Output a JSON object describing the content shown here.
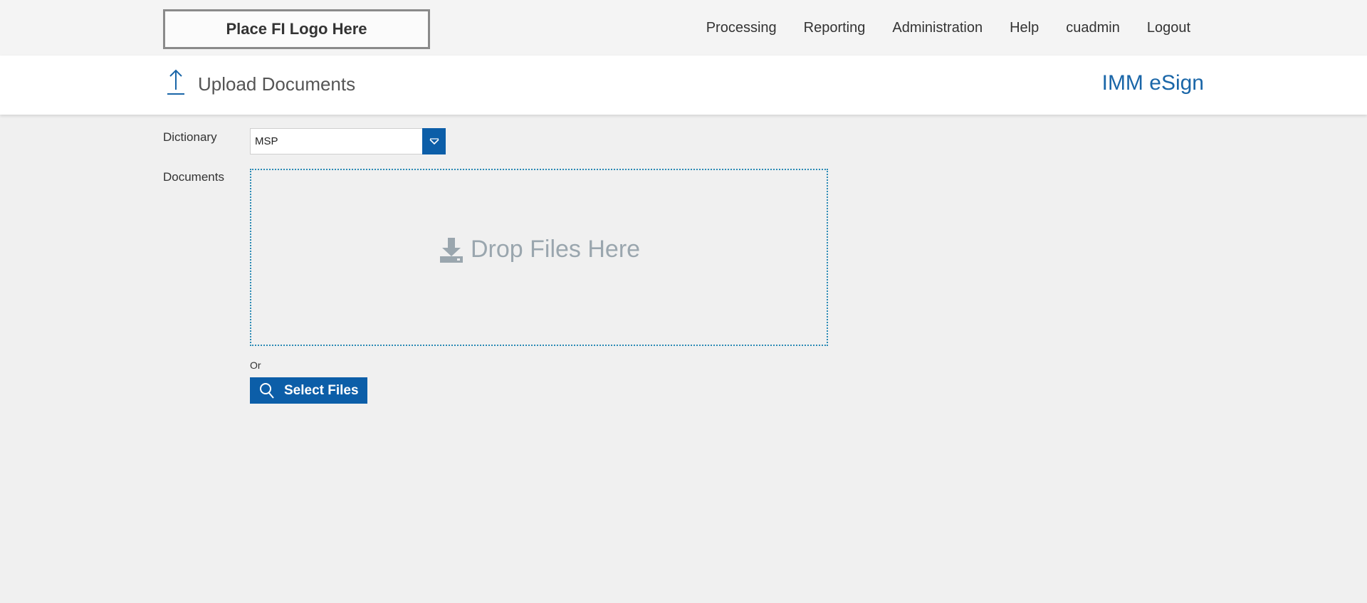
{
  "header": {
    "logo_text": "Place FI Logo Here",
    "nav": [
      {
        "label": "Processing"
      },
      {
        "label": "Reporting"
      },
      {
        "label": "Administration"
      },
      {
        "label": "Help"
      },
      {
        "label": "cuadmin"
      },
      {
        "label": "Logout"
      }
    ]
  },
  "titlebar": {
    "icon": "upload-arrow-icon",
    "title": "Upload Documents",
    "brand": "IMM eSign"
  },
  "form": {
    "dictionary_label": "Dictionary",
    "dictionary_value": "MSP",
    "documents_label": "Documents",
    "drop_text": "Drop Files Here",
    "drop_icon": "download-tray-icon",
    "or_text": "Or",
    "select_button_label": "Select Files",
    "select_button_icon": "search-icon"
  },
  "colors": {
    "accent": "#0c5ea8",
    "brand": "#1a66a8",
    "dropzone_border": "#2a8ab5",
    "drop_text": "#9aa6ae"
  }
}
